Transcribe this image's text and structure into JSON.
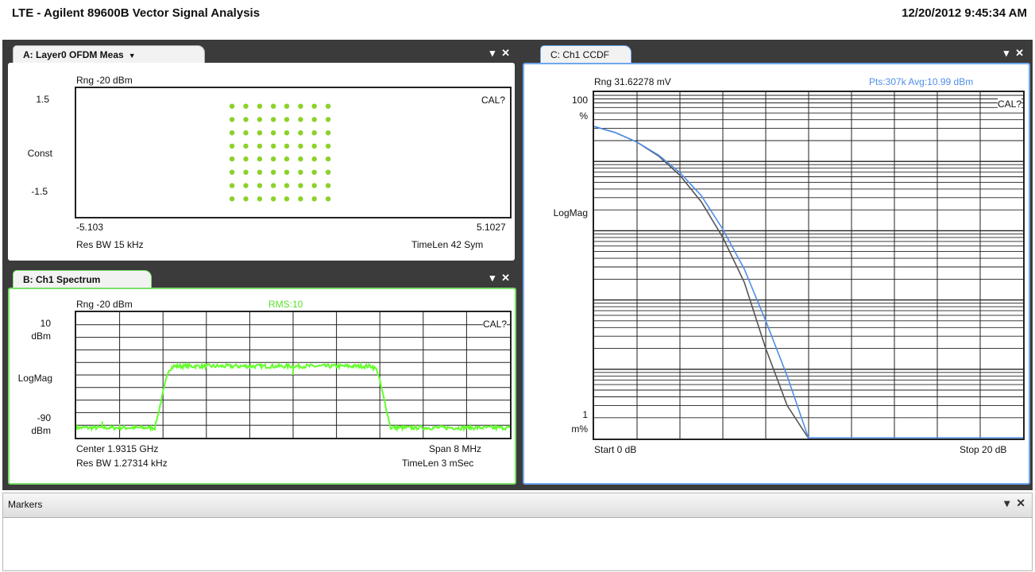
{
  "app_title": "LTE - Agilent 89600B Vector Signal Analysis",
  "timestamp": "12/20/2012 9:45:34 AM",
  "window_controls": {
    "pin": "▾",
    "close": "✕"
  },
  "colors": {
    "trace_green": "#62ff29",
    "const_green": "#8cd12a",
    "ccdf_blue": "#4f8ee8",
    "active_border_green": "#7ae06a",
    "active_border_blue": "#6fa8ef"
  },
  "panel_a": {
    "tab": "A: Layer0 OFDM Meas",
    "range": "Rng -20 dBm",
    "y_top": "1.5",
    "y_mid": "Const",
    "y_bottom": "-1.5",
    "cal": "CAL?",
    "x_left": "-5.103",
    "x_right": "5.1027",
    "footer_left": "Res BW 15 kHz",
    "footer_right": "TimeLen 42  Sym"
  },
  "panel_b": {
    "tab": "B: Ch1 Spectrum",
    "range": "Rng -20 dBm",
    "rms": "RMS:10",
    "y_top": "10",
    "y_top_unit": "dBm",
    "y_mid": "LogMag",
    "y_bottom": "-90",
    "y_bottom_unit": "dBm",
    "cal": "CAL?",
    "center": "Center 1.9315 GHz",
    "span": "Span 8 MHz",
    "res_bw": "Res BW 1.27314 kHz",
    "timelen": "TimeLen 3 mSec"
  },
  "panel_c": {
    "tab": "C: Ch1 CCDF",
    "range": "Rng 31.62278 mV",
    "stats": "Pts:307k Avg:10.99 dBm",
    "y_top": "100",
    "y_top_unit": "%",
    "y_mid": "LogMag",
    "y_bottom": "1",
    "y_bottom_unit": "m%",
    "cal": "CAL?",
    "start": "Start 0 dB",
    "stop": "Stop 20 dB"
  },
  "markers": {
    "title": "Markers"
  },
  "chart_data": [
    {
      "type": "scatter",
      "name": "A: Layer0 OFDM Meas constellation",
      "x": [
        -1.08,
        -0.77,
        -0.46,
        -0.15,
        0.15,
        0.46,
        0.77,
        1.08
      ],
      "y": [
        1.08,
        0.77,
        0.46,
        0.15,
        -0.15,
        -0.46,
        -0.77,
        -1.08
      ],
      "grid": "8x8",
      "ylim": [
        -1.5,
        1.5
      ],
      "xlim": [
        -5.103,
        5.1027
      ],
      "xlabel": "",
      "ylabel": "Const"
    },
    {
      "type": "line",
      "name": "B: Ch1 Spectrum",
      "x_mhz": [
        -4,
        -3.1,
        -2.55,
        -2.3,
        -2.2,
        1.45,
        1.55,
        1.8,
        4
      ],
      "y_dbm": [
        -82,
        -82,
        -82,
        -36,
        -33,
        -33,
        -36,
        -82,
        -82
      ],
      "ylim": [
        -90,
        10
      ],
      "ylabel": "LogMag",
      "grid": true
    },
    {
      "type": "line",
      "name": "C: Ch1 CCDF",
      "x_db": [
        0,
        1,
        2,
        3,
        4,
        5,
        6,
        7,
        8,
        9,
        10
      ],
      "series": [
        {
          "values_pct": [
            32,
            26,
            19,
            12,
            6.3,
            2.6,
            0.8,
            0.18,
            0.02,
            0.003,
            0.001
          ]
        },
        {
          "values_pct": [
            32,
            26,
            19,
            12.4,
            6.9,
            3.2,
            1.05,
            0.28,
            0.05,
            0.008,
            0.001
          ]
        }
      ],
      "xlim": [
        0,
        20
      ],
      "ylim_pct": [
        0.001,
        100
      ],
      "ylabel": "LogMag",
      "grid": true
    }
  ]
}
